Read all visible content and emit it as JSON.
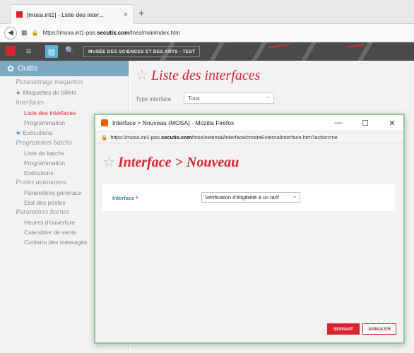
{
  "browser": {
    "tab_title": "[mosa.int1] - Liste des inter...",
    "tab_close": "×",
    "new_tab": "+",
    "back": "◀",
    "site_icon": "▦",
    "lock": "🔒",
    "url_prefix": "https://mosa.int1-pos.",
    "url_domain": "secutix.com",
    "url_suffix": "/tnss/mainIndex.htm"
  },
  "app": {
    "org_name": "MUSÉE DES SCIENCES ET DES ARTS - TEST",
    "menu_icon": "▤",
    "search_icon": "🔍",
    "home_icon": "≋"
  },
  "sidebar": {
    "header": "Outils",
    "gear_icon": "✿",
    "entries": [
      {
        "kind": "group",
        "label": "Paramétrage maquettes"
      },
      {
        "kind": "star",
        "label": "Maquettes de billets"
      },
      {
        "kind": "group",
        "label": "Interfaces"
      },
      {
        "kind": "active",
        "label": "Liste des interfaces"
      },
      {
        "kind": "item",
        "label": "Programmation"
      },
      {
        "kind": "star",
        "label": "Exécutions"
      },
      {
        "kind": "group",
        "label": "Programmes batchs"
      },
      {
        "kind": "item",
        "label": "Liste de batchs"
      },
      {
        "kind": "item",
        "label": "Programmation"
      },
      {
        "kind": "item",
        "label": "Exécutions"
      },
      {
        "kind": "group",
        "label": "Postes autonomes"
      },
      {
        "kind": "item",
        "label": "Paramètres généraux"
      },
      {
        "kind": "item",
        "label": "Etat des postes"
      },
      {
        "kind": "group",
        "label": "Paramètres bornes"
      },
      {
        "kind": "item",
        "label": "Heures d'ouverture"
      },
      {
        "kind": "item",
        "label": "Calendrier de vente"
      },
      {
        "kind": "item",
        "label": "Contenu des messages"
      }
    ]
  },
  "main": {
    "star": "☆",
    "title": "Liste des interfaces",
    "type_label": "Type interface",
    "type_value": "Tous"
  },
  "popup": {
    "title": "Interface > Nouveau (MOSA) - Mozilla Firefox",
    "minimize": "—",
    "maximize": "☐",
    "close": "✕",
    "lock": "🔒",
    "url_prefix": "https://mosa.int1-pos.",
    "url_domain": "secutix.com",
    "url_suffix": "/tnss/external/interface/createExternalInterface.htm?action=ne",
    "star": "☆",
    "heading": "Interface > Nouveau",
    "field_label": "Interface",
    "required_mark": " *",
    "field_value": "Vérification d'éligibilité à un tarif",
    "next_button": "SUIVANT",
    "cancel_button": "ANNULER"
  },
  "colors": {
    "brand_red": "#d9232f",
    "sidebar_header": "#7ca7c2",
    "popup_border": "#8fc9a2"
  }
}
